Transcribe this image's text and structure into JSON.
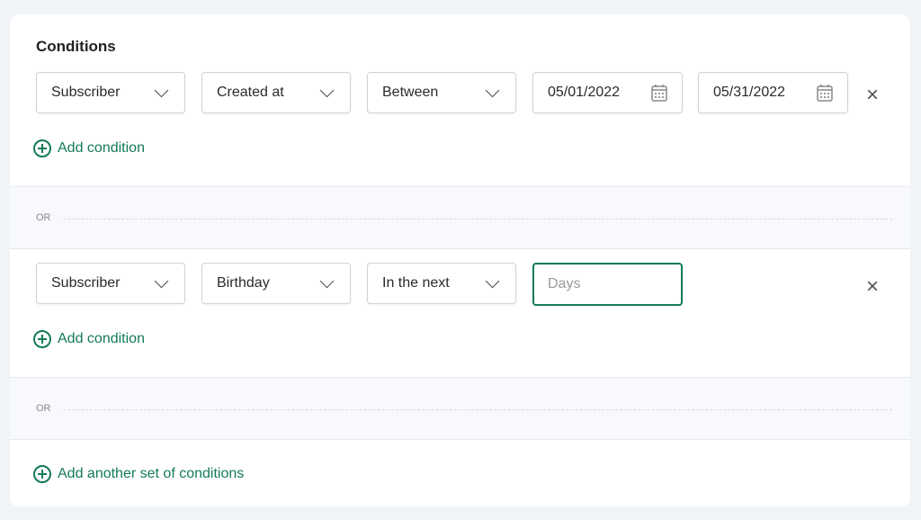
{
  "title": "Conditions",
  "groups": [
    {
      "fields": [
        "Subscriber",
        "Created at",
        "Between"
      ],
      "dates": [
        "05/01/2022",
        "05/31/2022"
      ],
      "add_label": "Add condition"
    },
    {
      "fields": [
        "Subscriber",
        "Birthday",
        "In the next"
      ],
      "days_placeholder": "Days",
      "add_label": "Add condition"
    }
  ],
  "or_label": "OR",
  "add_set_label": "Add another set of conditions",
  "colors": {
    "accent": "#137a5a",
    "background": "#f0f3f8"
  }
}
